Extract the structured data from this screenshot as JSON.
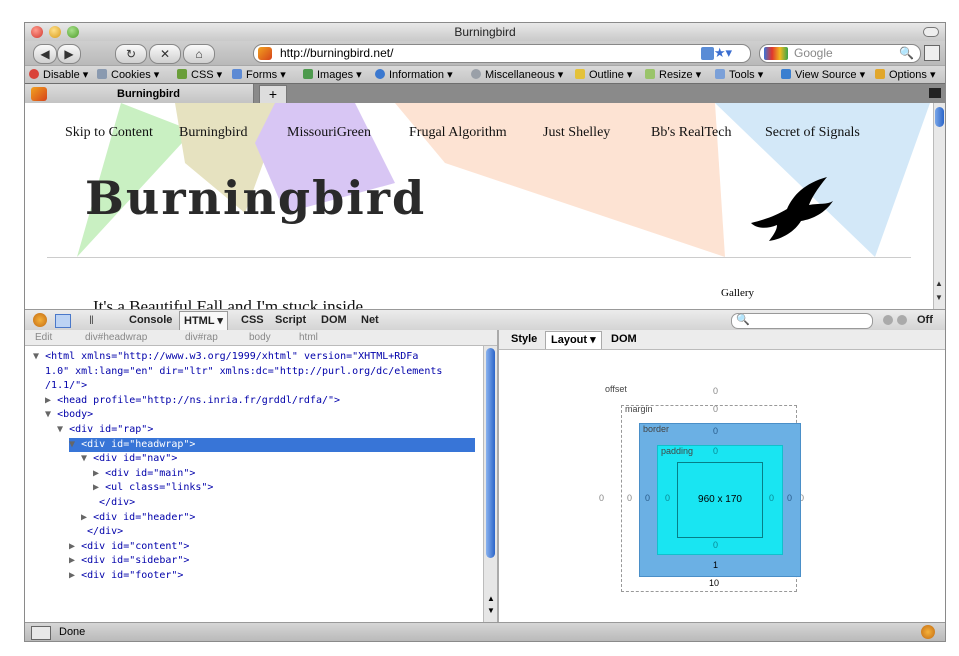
{
  "window": {
    "title": "Burningbird"
  },
  "nav": {
    "url": "http://burningbird.net/",
    "search_placeholder": "Google"
  },
  "devbar": {
    "items": [
      "Disable",
      "Cookies",
      "CSS",
      "Forms",
      "Images",
      "Information",
      "Miscellaneous",
      "Outline",
      "Resize",
      "Tools",
      "View Source",
      "Options"
    ]
  },
  "tabs": [
    {
      "label": "Burningbird"
    }
  ],
  "newtab_label": "+",
  "page": {
    "nav_links": [
      "Skip to Content",
      "Burningbird",
      "MissouriGreen",
      "Frugal Algorithm",
      "Just Shelley",
      "Bb's RealTech",
      "Secret of Signals"
    ],
    "brand": "Burningbird",
    "headline": "It's a Beautiful Fall and I'm stuck inside",
    "gallery": "Gallery"
  },
  "firebug": {
    "tabs": [
      "Console",
      "HTML",
      "CSS",
      "Script",
      "DOM",
      "Net"
    ],
    "selected_tab": "HTML",
    "off_label": "Off",
    "breadcrumbs": [
      "Edit",
      "div#headwrap",
      "div#rap",
      "body",
      "html"
    ],
    "side_tabs": [
      "Style",
      "Layout",
      "DOM"
    ],
    "selected_side_tab": "Layout"
  },
  "tree": {
    "lines": [
      {
        "indent": 0,
        "arrow": "▼",
        "text": "<html xmlns=\"http://www.w3.org/1999/xhtml\" version=\"XHTML+RDFa"
      },
      {
        "indent": 1,
        "arrow": "",
        "text": "1.0\" xml:lang=\"en\" dir=\"ltr\" xmlns:dc=\"http://purl.org/dc/elements"
      },
      {
        "indent": 1,
        "arrow": "",
        "text": "/1.1/\">"
      },
      {
        "indent": 2,
        "arrow": "▶",
        "text": "<head profile=\"http://ns.inria.fr/grddl/rdfa/\">"
      },
      {
        "indent": 2,
        "arrow": "▼",
        "text": "<body>"
      },
      {
        "indent": 4,
        "arrow": "▼",
        "text": "<div id=\"rap\">"
      },
      {
        "indent": 6,
        "arrow": "▼",
        "text": "<div id=\"headwrap\">"
      },
      {
        "indent": 8,
        "arrow": "▼",
        "text": "<div id=\"nav\">"
      },
      {
        "indent": 10,
        "arrow": "▶",
        "text": "<div id=\"main\">"
      },
      {
        "indent": 10,
        "arrow": "▶",
        "text": "<ul class=\"links\">"
      },
      {
        "indent": 10,
        "arrow": "",
        "text": "</div>"
      },
      {
        "indent": 8,
        "arrow": "▶",
        "text": "<div id=\"header\">"
      },
      {
        "indent": 8,
        "arrow": "",
        "text": "</div>"
      },
      {
        "indent": 6,
        "arrow": "▶",
        "text": "<div id=\"content\">"
      },
      {
        "indent": 6,
        "arrow": "▶",
        "text": "<div id=\"sidebar\">"
      },
      {
        "indent": 6,
        "arrow": "▶",
        "text": "<div id=\"footer\">"
      }
    ],
    "selected_index": 6
  },
  "layout": {
    "offset_label": "offset",
    "offset_top": "0",
    "margin_label": "margin",
    "margin_top": "0",
    "margin_left": "0",
    "margin_right": "0",
    "margin_bottom": "10",
    "border_label": "border",
    "border_top": "0",
    "border_left": "0",
    "border_right": "0",
    "border_bottom": "1",
    "padding_label": "padding",
    "padding_top": "0",
    "padding_left": "0",
    "padding_right": "0",
    "padding_bottom": "0",
    "content_size": "960 x 170",
    "offset_left": "0",
    "offset_right": "0"
  },
  "status": {
    "text": "Done"
  },
  "colors": {
    "selection": "#3875d7",
    "border_box": "#6bb0e4",
    "padding_box": "#19e5f2"
  }
}
